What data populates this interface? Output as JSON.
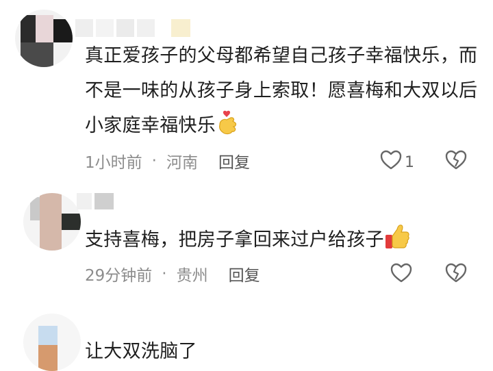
{
  "comments": [
    {
      "text": "真正爱孩子的父母都希望自己孩子幸福快乐，而不是一味的从孩子身上索取！愿喜梅和大双以后小家庭幸福快乐",
      "time": "1小时前",
      "location": "河南",
      "reply_label": "回复",
      "like_count": "1",
      "emoji": "finger-heart-emoji"
    },
    {
      "text": "支持喜梅，把房子拿回来过户给孩子",
      "time": "29分钟前",
      "location": "贵州",
      "reply_label": "回复",
      "like_count": "",
      "emoji": "thumbs-up-emoji"
    },
    {
      "text": "让大双洗脑了",
      "time": "",
      "location": "",
      "reply_label": "",
      "like_count": "",
      "emoji": ""
    }
  ],
  "colors": {
    "text": "#1f1f1f",
    "meta": "#8c8c8c",
    "icon": "#666666"
  }
}
